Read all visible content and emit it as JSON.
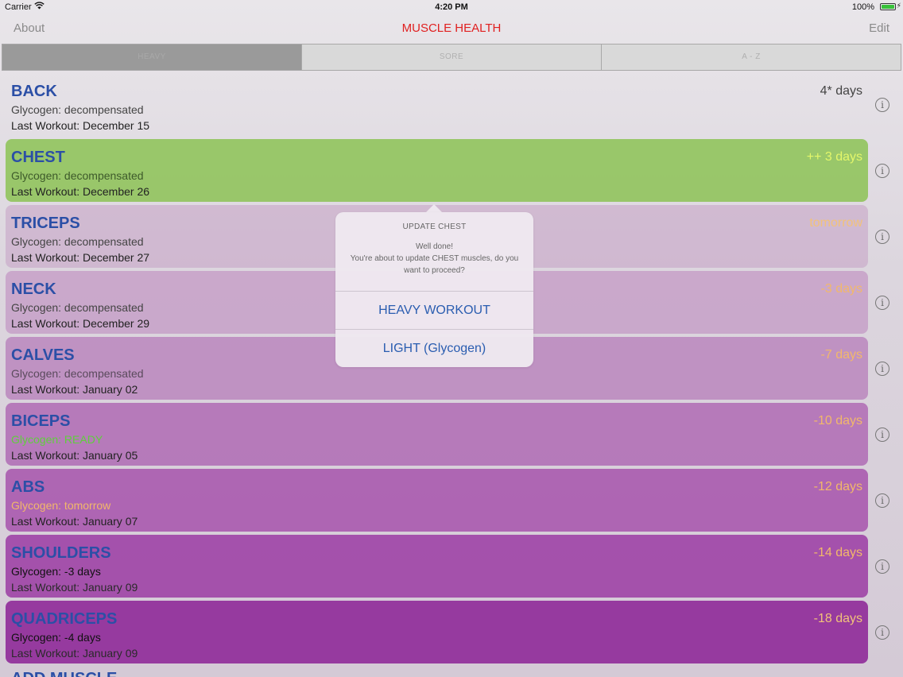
{
  "status_bar": {
    "carrier": "Carrier",
    "time": "4:20 PM",
    "battery": "100%"
  },
  "nav": {
    "left": "About",
    "title": "MUSCLE HEALTH",
    "right": "Edit"
  },
  "segments": [
    "HEAVY",
    "SORE",
    "A - Z"
  ],
  "muscles": [
    {
      "name": "BACK",
      "glycogen": "Glycogen: decompensated",
      "last": "Last Workout: December 15",
      "days": "4* days"
    },
    {
      "name": "CHEST",
      "glycogen": "Glycogen: decompensated",
      "last": "Last Workout: December 26",
      "days": "++ 3 days"
    },
    {
      "name": "TRICEPS",
      "glycogen": "Glycogen: decompensated",
      "last": "Last Workout: December 27",
      "days": "tomorrow"
    },
    {
      "name": "NECK",
      "glycogen": "Glycogen: decompensated",
      "last": "Last Workout: December 29",
      "days": "-3 days"
    },
    {
      "name": "CALVES",
      "glycogen": "Glycogen: decompensated",
      "last": "Last Workout: January 02",
      "days": "-7 days"
    },
    {
      "name": "BICEPS",
      "glycogen": "Glycogen: READY",
      "last": "Last Workout: January 05",
      "days": "-10 days"
    },
    {
      "name": "ABS",
      "glycogen": "Glycogen: tomorrow",
      "last": "Last Workout: January 07",
      "days": "-12 days"
    },
    {
      "name": "SHOULDERS",
      "glycogen": "Glycogen: -3 days",
      "last": "Last Workout: January 09",
      "days": "-14 days"
    },
    {
      "name": "QUADRICEPS",
      "glycogen": "Glycogen: -4 days",
      "last": "Last Workout: January 09",
      "days": "-18 days"
    }
  ],
  "add_muscle": "ADD MUSCLE",
  "popover": {
    "title": "UPDATE CHEST",
    "message_line1": "Well done!",
    "message_line2": "You're about to update CHEST muscles, do you want to proceed?",
    "heavy_button": "HEAVY WORKOUT",
    "light_button": "LIGHT (Glycogen)"
  },
  "colors": {
    "title_red": "#e02020",
    "name_blue": "#2b4fa6",
    "chest_green": "#93c45f",
    "ready_green": "#5fcf3c",
    "tomorrow_orange": "#f2b86a",
    "button_blue": "#2a5db0"
  }
}
